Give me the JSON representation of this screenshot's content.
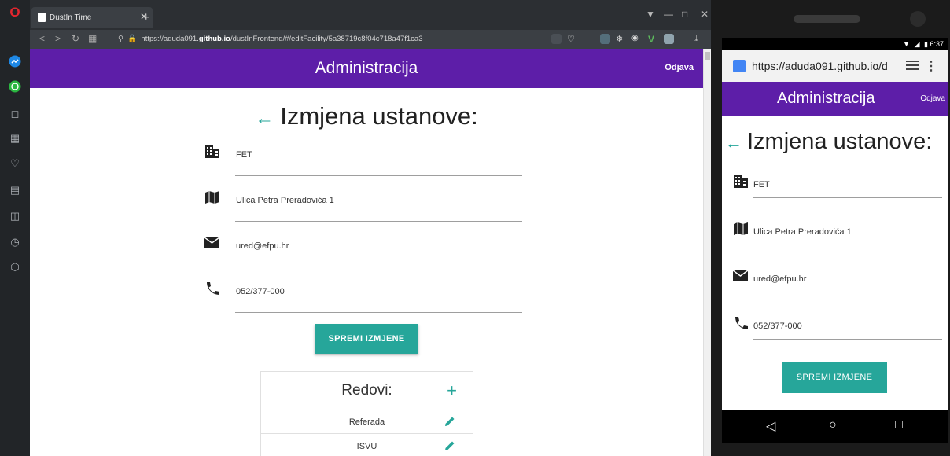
{
  "browser": {
    "tab_title": "DustIn Time",
    "url_prefix": "https://aduda091.",
    "url_host": "github.io",
    "url_path": "/dustInFrontend/#/editFacility/5a38719c8f04c718a47f1ca3"
  },
  "app": {
    "header_title": "Administracija",
    "logout_label": "Odjava",
    "page_heading": "Izmjena ustanove:",
    "fields": {
      "name": "FET",
      "address": "Ulica Petra Preradovića 1",
      "email": "ured@efpu.hr",
      "phone": "052/377-000"
    },
    "save_label": "SPREMI IZMJENE",
    "rows": {
      "title": "Redovi:",
      "items": [
        "Referada",
        "ISVU"
      ]
    },
    "accent_color": "#26a69a",
    "header_color": "#5d1ea8"
  },
  "phone": {
    "clock": "6:37",
    "url": "https://aduda091.github.io/d"
  }
}
